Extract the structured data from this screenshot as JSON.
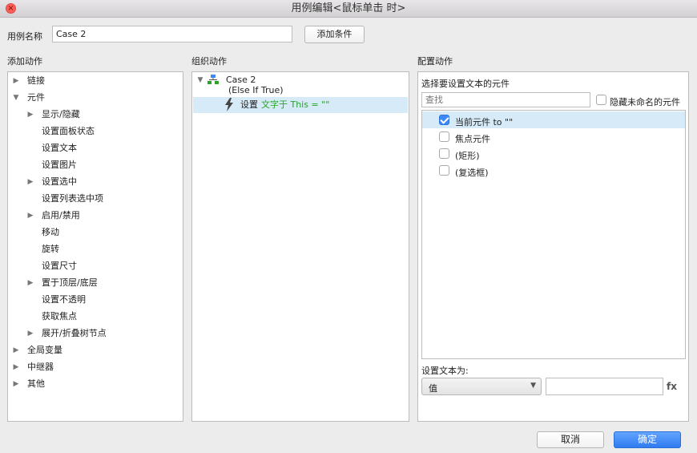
{
  "window": {
    "title": "用例编辑<鼠标单击 时>",
    "close_glyph": "×"
  },
  "case_name": {
    "label": "用例名称",
    "value": "Case 2",
    "add_condition": "添加条件"
  },
  "add_actions": {
    "heading": "添加动作",
    "items": [
      {
        "label": "链接",
        "level": 0,
        "arrow": "▶"
      },
      {
        "label": "元件",
        "level": 0,
        "arrow": "▼"
      },
      {
        "label": "显示/隐藏",
        "level": 1,
        "arrow": "▶"
      },
      {
        "label": "设置面板状态",
        "level": 1,
        "arrow": ""
      },
      {
        "label": "设置文本",
        "level": 1,
        "arrow": ""
      },
      {
        "label": "设置图片",
        "level": 1,
        "arrow": ""
      },
      {
        "label": "设置选中",
        "level": 1,
        "arrow": "▶"
      },
      {
        "label": "设置列表选中项",
        "level": 1,
        "arrow": ""
      },
      {
        "label": "启用/禁用",
        "level": 1,
        "arrow": "▶"
      },
      {
        "label": "移动",
        "level": 1,
        "arrow": ""
      },
      {
        "label": "旋转",
        "level": 1,
        "arrow": ""
      },
      {
        "label": "设置尺寸",
        "level": 1,
        "arrow": ""
      },
      {
        "label": "置于顶层/底层",
        "level": 1,
        "arrow": "▶"
      },
      {
        "label": "设置不透明",
        "level": 1,
        "arrow": ""
      },
      {
        "label": "获取焦点",
        "level": 1,
        "arrow": ""
      },
      {
        "label": "展开/折叠树节点",
        "level": 1,
        "arrow": "▶"
      },
      {
        "label": "全局变量",
        "level": 0,
        "arrow": "▶"
      },
      {
        "label": "中继器",
        "level": 0,
        "arrow": "▶"
      },
      {
        "label": "其他",
        "level": 0,
        "arrow": "▶"
      }
    ]
  },
  "organize": {
    "heading": "组织动作",
    "case_label": "Case 2",
    "case_condition": "(Else If True)",
    "action_verb": "设置",
    "action_detail": "文字于 This = \"\""
  },
  "configure": {
    "heading": "配置动作",
    "select_label": "选择要设置文本的元件",
    "search_placeholder": "查找",
    "hide_unnamed": "隐藏未命名的元件",
    "widgets": [
      {
        "label": "当前元件 to \"\"",
        "checked": true
      },
      {
        "label": "焦点元件",
        "checked": false
      },
      {
        "label": "(矩形)",
        "checked": false
      },
      {
        "label": "(复选框)",
        "checked": false
      }
    ],
    "set_text_label": "设置文本为:",
    "value_type": "值",
    "value_text": "",
    "fx_label": "fx"
  },
  "footer": {
    "cancel": "取消",
    "ok": "确定"
  },
  "colors": {
    "accent": "#3b88f6",
    "selection": "#d6ebf7",
    "green": "#27a327"
  }
}
